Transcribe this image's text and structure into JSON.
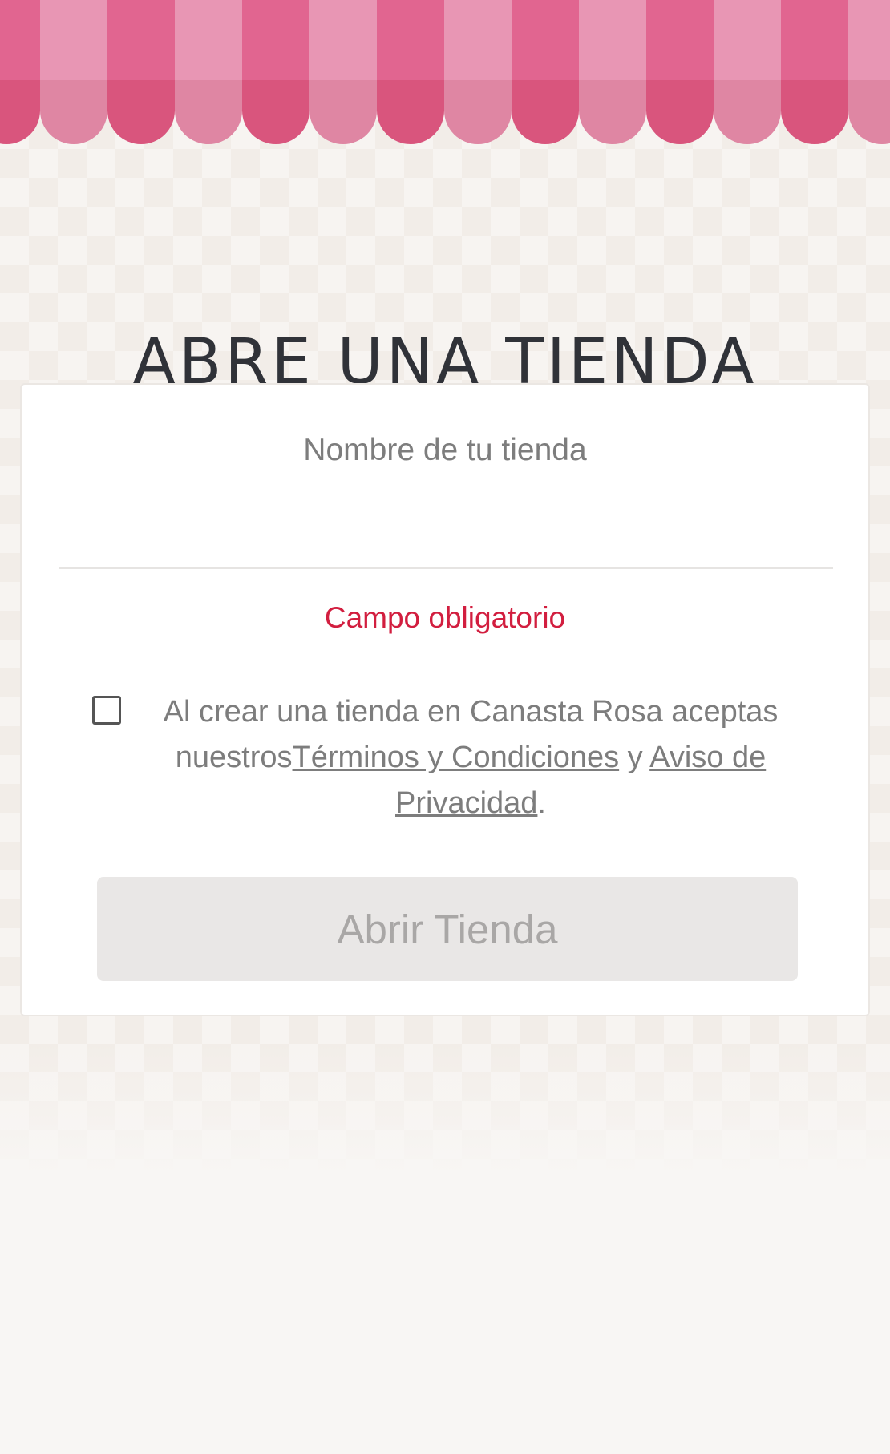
{
  "brand_colors": {
    "awning_dark": "#e16590",
    "awning_light": "#e896b4",
    "error": "#d21e3f",
    "title": "#303238"
  },
  "page": {
    "title": "ABRE UNA TIENDA"
  },
  "form": {
    "store_name_label": "Nombre de tu tienda",
    "store_name_value": "",
    "error_text": "Campo obligatorio",
    "terms": {
      "checked": false,
      "prefix": "Al crear una tienda en Canasta Rosa aceptas nuestros",
      "terms_link": "Términos y Condiciones",
      "conjunction": " y ",
      "privacy_link": "Aviso de Privacidad",
      "suffix": "."
    },
    "submit_label": "Abrir Tienda",
    "submit_disabled": true
  }
}
